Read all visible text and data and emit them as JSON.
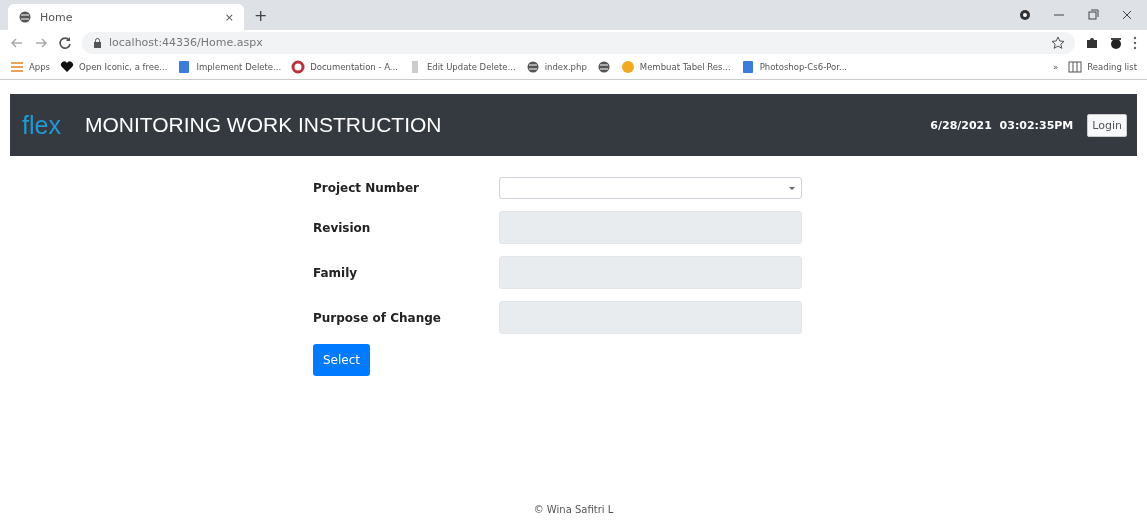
{
  "browser": {
    "tab": {
      "title": "Home",
      "close": "×"
    },
    "new_tab": "+",
    "url": "localhost:44336/Home.aspx",
    "bookmarks": [
      {
        "kind": "labeled",
        "label": "Apps"
      },
      {
        "kind": "labeled",
        "label": "Open Iconic, a free..."
      },
      {
        "kind": "labeled",
        "label": "Implement Delete..."
      },
      {
        "kind": "labeled",
        "label": "Documentation - A..."
      },
      {
        "kind": "labeled",
        "label": "Edit Update Delete..."
      },
      {
        "kind": "labeled",
        "label": "index.php"
      },
      {
        "kind": "icon"
      },
      {
        "kind": "labeled",
        "label": "Membuat Tabel Res..."
      },
      {
        "kind": "labeled",
        "label": "Photoshop-Cs6-Por..."
      }
    ],
    "more": "»",
    "reading_list": "Reading list"
  },
  "header": {
    "logo": "flex",
    "title": "MONITORING WORK INSTRUCTION",
    "datetime": "6/28/2021  03:02:35PM",
    "login": "Login"
  },
  "form": {
    "fields": [
      {
        "label": "Project Number",
        "kind": "select",
        "disabled": false
      },
      {
        "label": "Revision",
        "kind": "text",
        "disabled": true
      },
      {
        "label": "Family",
        "kind": "text",
        "disabled": true
      },
      {
        "label": "Purpose of Change",
        "kind": "text",
        "disabled": true
      }
    ],
    "submit": "Select"
  },
  "footer": "© Wina Safitri L"
}
